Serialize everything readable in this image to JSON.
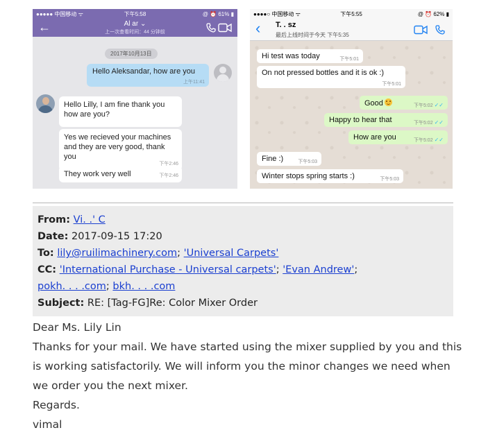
{
  "viber": {
    "status": {
      "carrier": "●●●●● 中国移动 ᯤ",
      "time": "下午5:58",
      "right": "@ ⏰ 61% ▮"
    },
    "header": {
      "contact": "Al          ar ⌄",
      "last_seen": "上一次查看时间：44 分钟前"
    },
    "date_badge": "2017年10月13日",
    "outgoing": {
      "text": "Hello Aleksandar, how are you",
      "time": "上午11:41"
    },
    "incoming": [
      {
        "text": "Hello Lilly, I am fine thank you how are you?",
        "time": ""
      },
      {
        "text": "Yes we recieved your machines and they are very good, thank you",
        "time": "下午2:46"
      },
      {
        "text": "They work very well",
        "time": "下午2:46"
      }
    ]
  },
  "whatsapp": {
    "status": {
      "carrier": "●●●●○ 中国移动 ᯤ",
      "time": "下午5:55",
      "right": "@ ⏰ 62% ▮"
    },
    "header": {
      "contact": "T.  .  sz",
      "last_seen": "最后上线时间于今天 下午5:35"
    },
    "messages": [
      {
        "dir": "in",
        "text": "Hi test was today",
        "time": "下午5:01",
        "emoji": false
      },
      {
        "dir": "in",
        "text": "On not pressed bottles and it is ok :)",
        "time": "下午5:01",
        "emoji": false
      },
      {
        "dir": "out",
        "text": "Good",
        "time": "下午5:02",
        "emoji": true
      },
      {
        "dir": "out",
        "text": "Happy to hear that",
        "time": "下午5:02",
        "emoji": false
      },
      {
        "dir": "out",
        "text": "How are you",
        "time": "下午5:02",
        "emoji": false
      },
      {
        "dir": "in",
        "text": "Fine :)",
        "time": "下午5:03",
        "emoji": false
      },
      {
        "dir": "in",
        "text": "Winter stops spring starts :)",
        "time": "下午5:03",
        "emoji": false
      }
    ],
    "tick_glyph": "✓✓"
  },
  "email": {
    "from_label": "From:",
    "from_value": "Vi.  .' C",
    "date_label": "Date:",
    "date_value": "2017-09-15 17:20",
    "to_label": "To:",
    "to_links": [
      "lily@ruilimachinery.com",
      "'Universal Carpets'"
    ],
    "cc_label": "CC:",
    "cc_links": [
      "'International Purchase - Universal carpets'",
      "'Evan Andrew'"
    ],
    "cc_links_line2": [
      "pokh.      .               .   .com",
      "bkh.  .               .   .com"
    ],
    "subject_label": "Subject:",
    "subject_value": "RE: [Tag-FG]Re: Color Mixer Order",
    "body": [
      "Dear Ms. Lily Lin",
      "Thanks for your mail. We have started using the mixer supplied by you and this",
      "is working satisfactorily. We will inform you the minor changes we need when",
      "we order you the next mixer.",
      "Regards.",
      "vimal"
    ]
  }
}
